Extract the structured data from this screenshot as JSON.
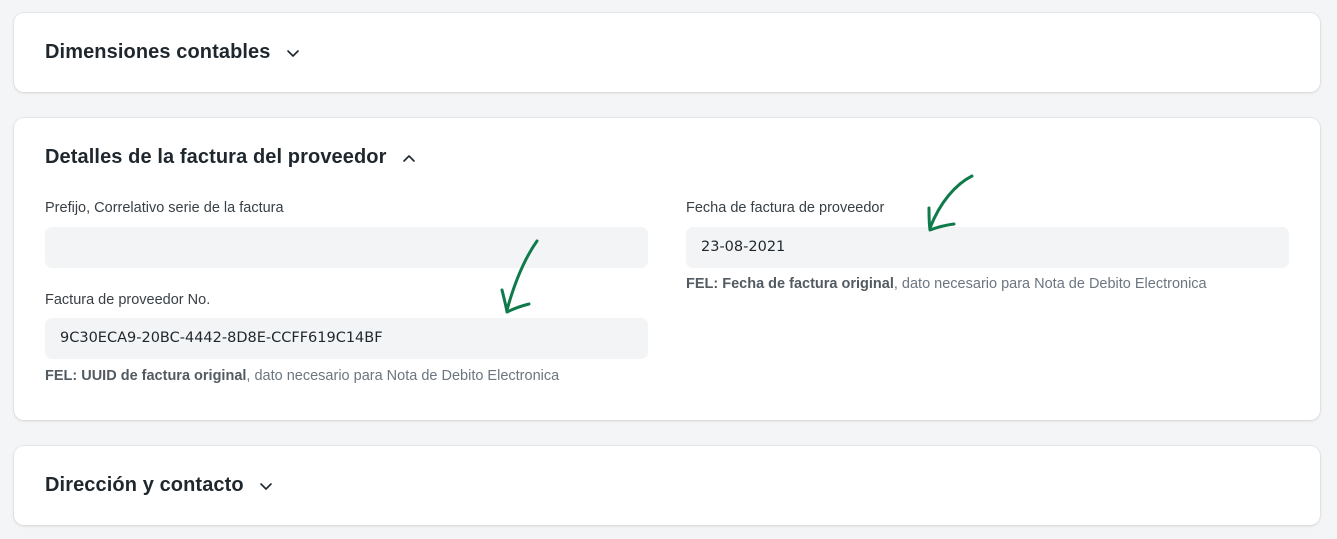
{
  "sections": {
    "accounting": {
      "title": "Dimensiones contables",
      "expanded": false
    },
    "supplier_invoice": {
      "title": "Detalles de la factura del proveedor",
      "expanded": true,
      "fields": {
        "prefix": {
          "label": "Prefijo, Correlativo serie de la factura",
          "value": ""
        },
        "invoice_no": {
          "label": "Factura de proveedor No.",
          "value": "9C30ECA9-20BC-4442-8D8E-CCFF619C14BF",
          "help_bold": "FEL: UUID de factura original",
          "help_rest": ", dato necesario para Nota de Debito Electronica"
        },
        "invoice_date": {
          "label": "Fecha de factura de proveedor",
          "value": "23-08-2021",
          "help_bold": "FEL: Fecha de factura original",
          "help_rest": ", dato necesario para Nota de Debito Electronica"
        }
      }
    },
    "address_contact": {
      "title": "Dirección y contacto",
      "expanded": false
    }
  },
  "icons": {
    "collapsed": "chevron-down-icon",
    "expanded": "chevron-up-icon",
    "annotation": "hand-drawn-arrow-icon"
  },
  "colors": {
    "annotation_arrow": "#0f7a4a",
    "input_background": "#f3f4f5",
    "page_background": "#f4f5f6"
  }
}
